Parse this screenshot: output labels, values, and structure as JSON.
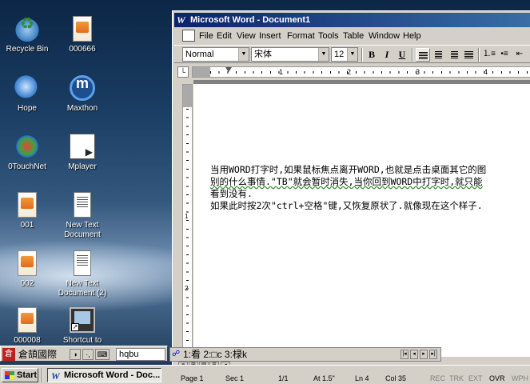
{
  "desktop": {
    "icons": [
      {
        "name": "recycle-bin",
        "label": "Recycle Bin"
      },
      {
        "name": "000666",
        "label": "000666"
      },
      {
        "name": "hope",
        "label": "Hope"
      },
      {
        "name": "maxthon",
        "label": "Maxthon"
      },
      {
        "name": "otouchnet",
        "label": "0TouchNet"
      },
      {
        "name": "mplayer",
        "label": "Mplayer"
      },
      {
        "name": "001",
        "label": "001"
      },
      {
        "name": "new-text-document",
        "label": "New Text Document"
      },
      {
        "name": "002",
        "label": "002"
      },
      {
        "name": "new-text-document-2",
        "label": "New Text Document (2)"
      },
      {
        "name": "000008",
        "label": "000008"
      },
      {
        "name": "shortcut",
        "label": "Shortcut to"
      }
    ]
  },
  "word": {
    "title": "Microsoft Word - Document1",
    "menu": [
      "File",
      "Edit",
      "View",
      "Insert",
      "Format",
      "Tools",
      "Table",
      "Window",
      "Help"
    ],
    "toolbar": {
      "style": "Normal",
      "font": "宋体",
      "size": "12",
      "bold": "B",
      "italic": "I",
      "underline": "U"
    },
    "ruler": {
      "numbers": [
        "1",
        "2",
        "3",
        "4"
      ]
    },
    "vruler": {
      "numbers": [
        "1",
        "2"
      ]
    },
    "document": {
      "lines": [
        "当用WORD打字时,如果鼠标焦点离开WORD,也就是点击桌面其它的图",
        "别的什么事情.\"TB\"就会暂时消失,当你回到WORD中打字时,就只能",
        "看到没有.",
        "如果此时按2次\"ctrl+空格\"键,又恢复原状了.就像现在这个样子."
      ]
    },
    "status": {
      "page": "Page 1",
      "sec": "Sec 1",
      "pages": "1/1",
      "at": "At 1.5\"",
      "ln": "Ln 4",
      "col": "Col 35",
      "rec": "REC",
      "trk": "TRK",
      "ext": "EXT",
      "ovr": "OVR",
      "wph": "WPH"
    }
  },
  "ime": {
    "name": "倉頡國際",
    "code": "hqbu",
    "candidates": "1:看 2:□c 3:椂k"
  },
  "taskbar": {
    "start": "Start",
    "task_word": "Microsoft Word - Doc..."
  }
}
